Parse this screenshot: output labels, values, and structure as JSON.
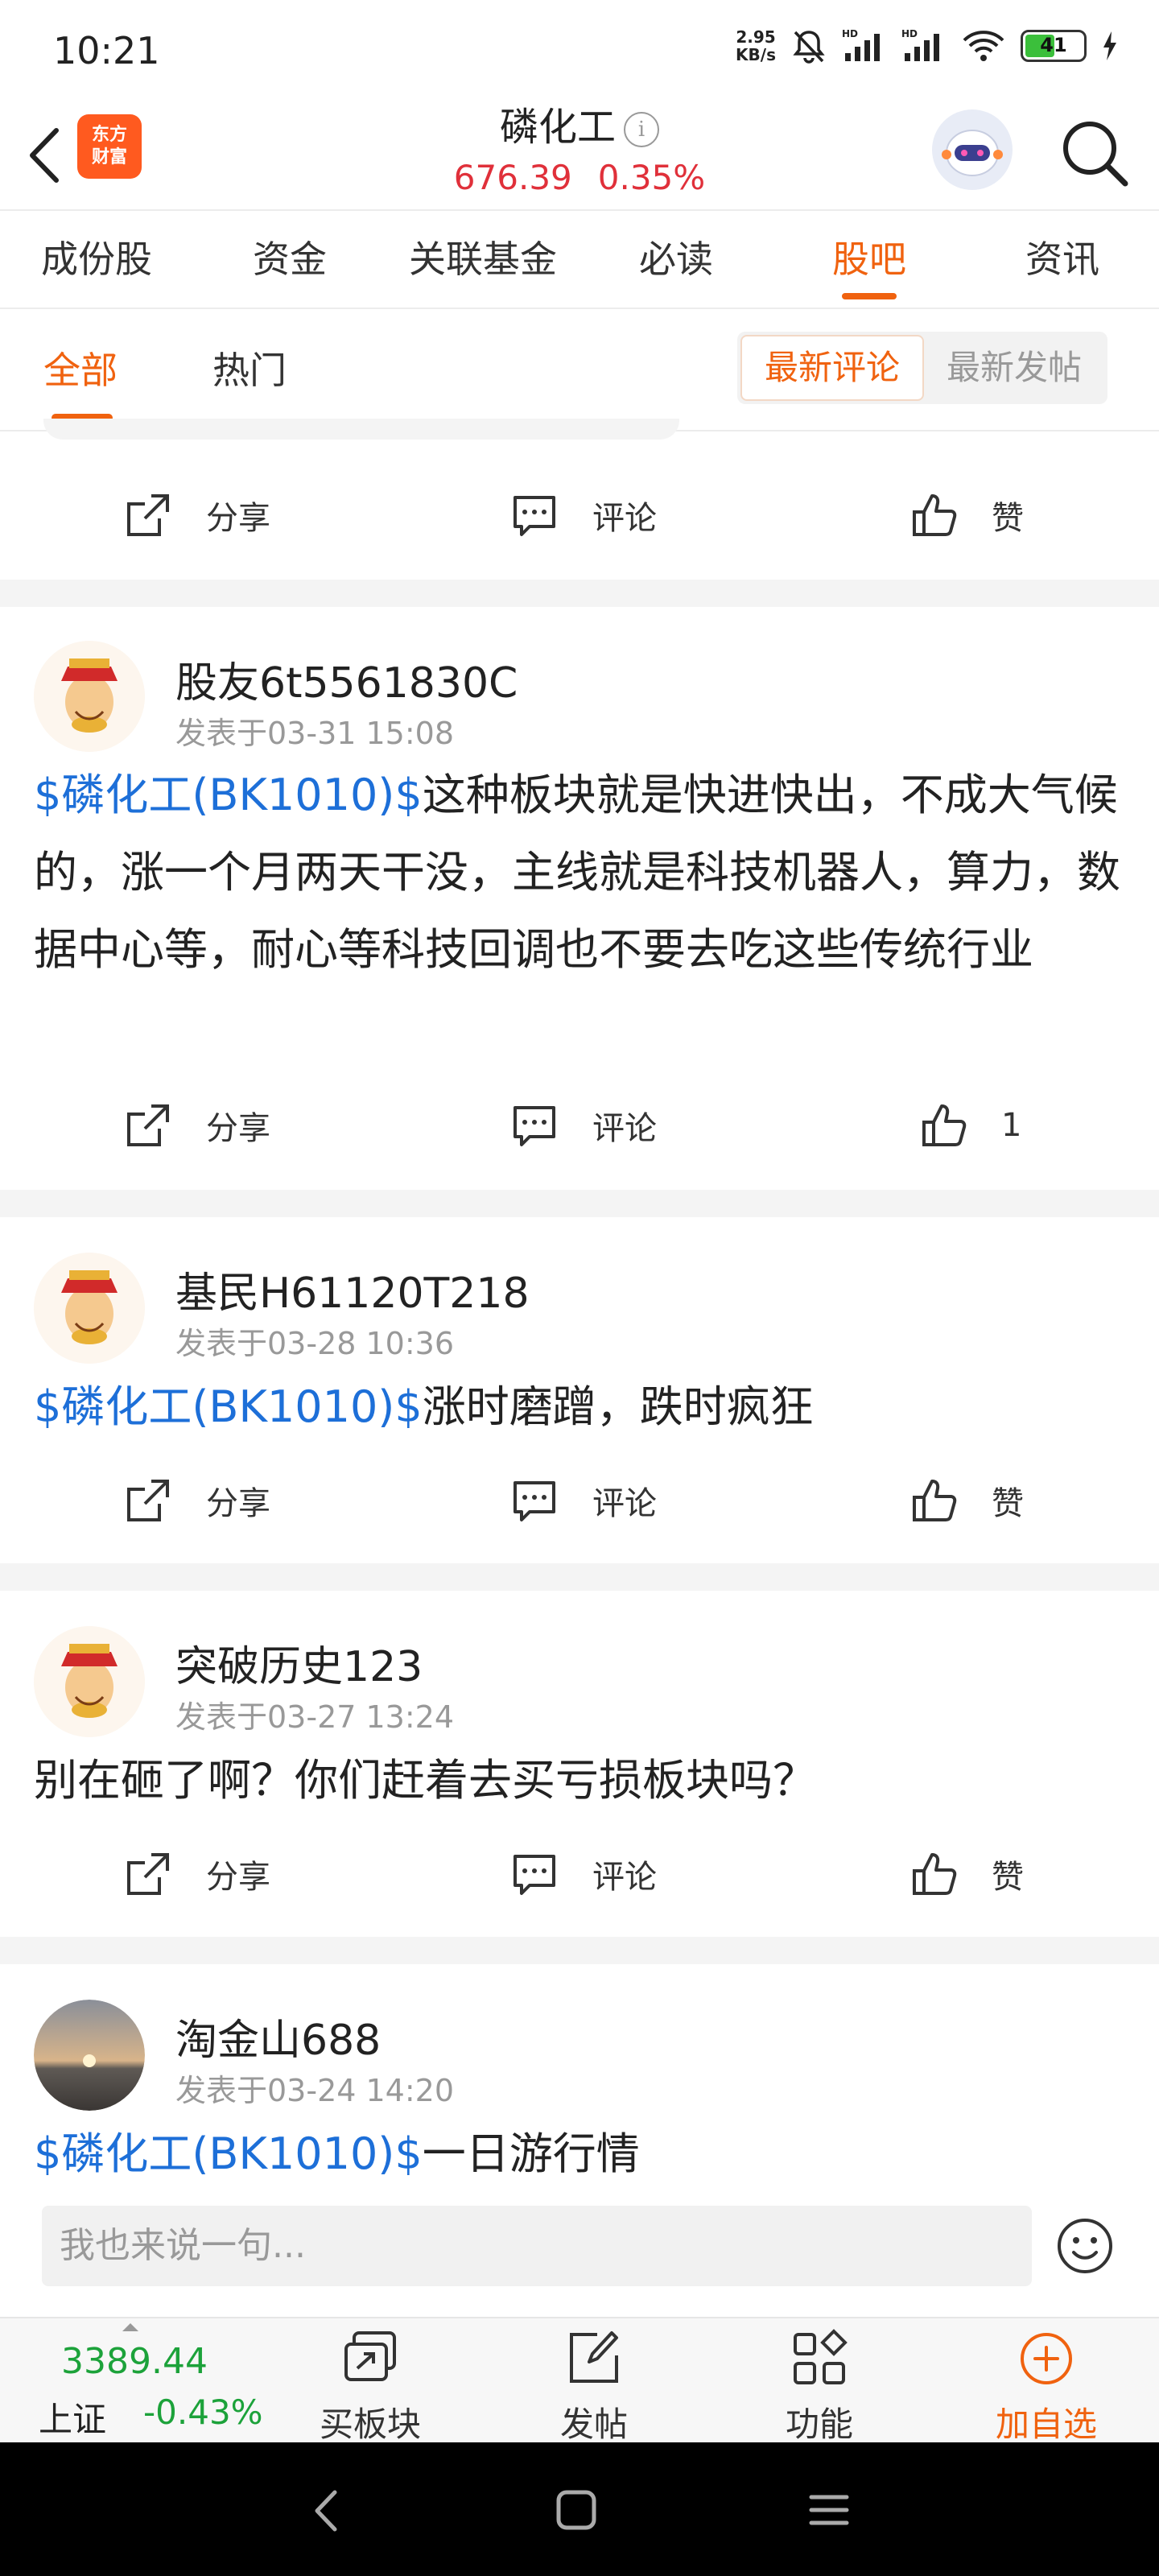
{
  "status_bar": {
    "time": "10:21",
    "net_speed_value": "2.95",
    "net_speed_unit": "KB/s",
    "battery": "41"
  },
  "header": {
    "app_logo_line1": "东方",
    "app_logo_line2": "财富",
    "title": "磷化工",
    "info_icon": "ⓘ",
    "price": "676.39",
    "change": "0.35%"
  },
  "tabs": [
    "成份股",
    "资金",
    "关联基金",
    "必读",
    "股吧",
    "资讯"
  ],
  "active_tab_index": 4,
  "subtabs": {
    "all": "全部",
    "hot": "热门",
    "sort_latest_comment": "最新评论",
    "sort_latest_post": "最新发帖"
  },
  "actions": {
    "share": "分享",
    "comment": "评论",
    "like": "赞"
  },
  "posts": [
    {
      "user": "股友6t5561830C",
      "time": "发表于03-31 15:08",
      "tag": "$磷化工(BK1010)$",
      "text": "这种板块就是快进快出，不成大气候的，涨一个月两天干没，主线就是科技机器人，算力，数据中心等，耐心等科技回调也不要去吃这些传统行业",
      "likes": "1"
    },
    {
      "user": "基民H61120T218",
      "time": "发表于03-28 10:36",
      "tag": "$磷化工(BK1010)$",
      "text": "涨时磨蹭，跌时疯狂",
      "likes": "赞"
    },
    {
      "user": "突破历史123",
      "time": "发表于03-27 13:24",
      "tag": "",
      "text": "别在砸了啊？你们赶着去买亏损板块吗？",
      "likes": "赞"
    },
    {
      "user": "淘金山688",
      "time": "发表于03-24 14:20",
      "tag": "$磷化工(BK1010)$",
      "text": "一日游行情"
    }
  ],
  "comment_bar": {
    "placeholder": "我也来说一句..."
  },
  "bottom_nav": {
    "index_value": "3389.44",
    "index_name": "上证",
    "index_change": "-0.43%",
    "items": [
      "买板块",
      "发帖",
      "功能",
      "加自选"
    ]
  },
  "colors": {
    "accent": "#f0620f",
    "up_red": "#e0303a",
    "down_green": "#1ca23a",
    "link_blue": "#1d6fd8"
  }
}
